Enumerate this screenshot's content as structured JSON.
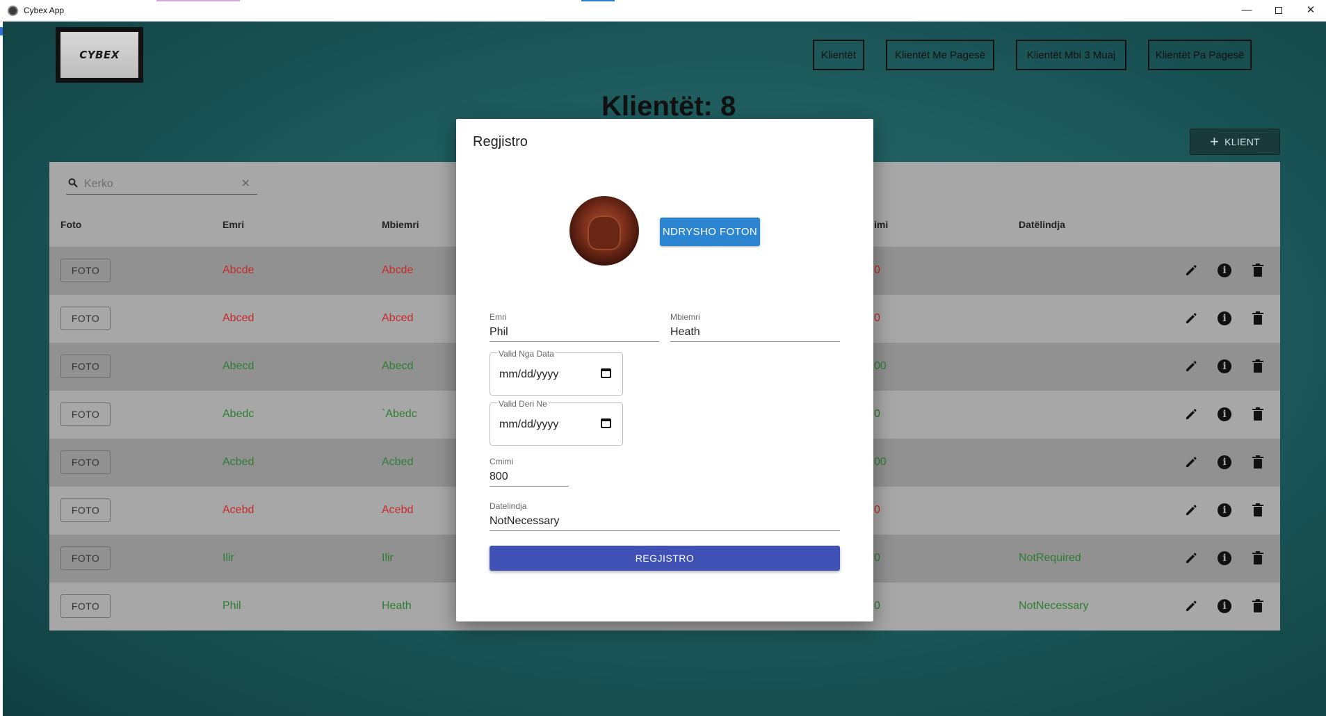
{
  "window": {
    "title": "Cybex App",
    "minimize": "—",
    "close": "✕"
  },
  "logo": {
    "text": "CYBEX"
  },
  "nav": [
    {
      "label": "Klientët"
    },
    {
      "label": "Klientët Me Pagesë"
    },
    {
      "label": "Klientët Mbi 3 Muaj"
    },
    {
      "label": "Klientët Pa Pagesë"
    }
  ],
  "page_title": "Klientët: 8",
  "add_button": {
    "icon": "plus-icon",
    "plus": "+",
    "label": "KLIENT"
  },
  "search": {
    "placeholder": "Kerko",
    "value": "",
    "clear": "✕"
  },
  "table": {
    "headers": {
      "foto": "Foto",
      "emri": "Emri",
      "mbiemri": "Mbiemri",
      "cmimi_partial": "imi",
      "datelindja": "Datëlindja"
    },
    "foto_button": "FOTO",
    "rows": [
      {
        "emri": "Abcde",
        "mbiemri": "Abcde",
        "cmimi_partial": "0",
        "datelindja": "",
        "status": "red"
      },
      {
        "emri": "Abced",
        "mbiemri": "Abced",
        "cmimi_partial": "0",
        "datelindja": "",
        "status": "red"
      },
      {
        "emri": "Abecd",
        "mbiemri": "Abecd",
        "cmimi_partial": "00",
        "datelindja": "",
        "status": "green"
      },
      {
        "emri": "Abedc",
        "mbiemri": "`Abedc",
        "cmimi_partial": "0",
        "datelindja": "",
        "status": "green"
      },
      {
        "emri": "Acbed",
        "mbiemri": "Acbed",
        "cmimi_partial": "00",
        "datelindja": "",
        "status": "green"
      },
      {
        "emri": "Acebd",
        "mbiemri": "Acebd",
        "cmimi_partial": "0",
        "datelindja": "",
        "status": "red"
      },
      {
        "emri": "Ilir",
        "mbiemri": "Ilir",
        "cmimi_partial": "0",
        "datelindja": "NotRequired",
        "status": "green"
      },
      {
        "emri": "Phil",
        "mbiemri": "Heath",
        "cmimi_partial": "0",
        "datelindja": "NotNecessary",
        "status": "green"
      }
    ]
  },
  "modal": {
    "title": "Regjistro",
    "change_photo": "NDRYSHO FOTON",
    "fields": {
      "emri": {
        "label": "Emri",
        "value": "Phil"
      },
      "mbiemri": {
        "label": "Mbiemri",
        "value": "Heath"
      },
      "valid_from": {
        "label": "Valid Nga Data",
        "value": "mm/dd/yyyy"
      },
      "valid_to": {
        "label": "Valid Deri Ne",
        "value": "mm/dd/yyyy"
      },
      "cmimi": {
        "label": "Cmimi",
        "value": "800"
      },
      "datelindja": {
        "label": "Datelindja",
        "value": "NotNecessary"
      }
    },
    "submit": "REGJISTRO"
  },
  "colors": {
    "red_text": "#c62828",
    "green_text": "#2e7d32",
    "primary_button": "#3f51b5",
    "photo_button": "#2b85d0",
    "add_button_bg": "#1a3a3a",
    "background": "#1f5e60"
  }
}
